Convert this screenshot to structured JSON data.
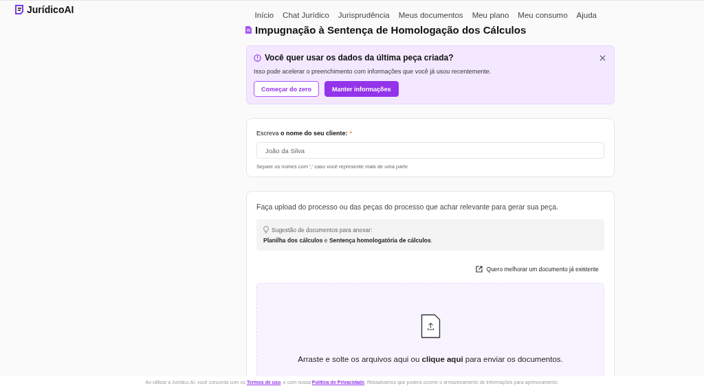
{
  "brand": {
    "name": "JurídicoAI"
  },
  "nav": [
    "Início",
    "Chat Jurídico",
    "Jurisprudência",
    "Meus documentos",
    "Meu plano",
    "Meu consumo",
    "Ajuda"
  ],
  "page_title": "Impugnação à Sentença de Homologação dos Cálculos",
  "alert": {
    "title": "Você quer usar os dados da última peça criada?",
    "text": "Isso pode acelerar o preenchimento com informações que você já usou recentemente.",
    "buttons": [
      {
        "label": "Começar do zero",
        "kind": "outline"
      },
      {
        "label": "Manter informações",
        "kind": "primary"
      }
    ]
  },
  "client_field": {
    "label": "Escreva **o nome do seu cliente:**",
    "required_mark": "*",
    "placeholder": "João da Silva",
    "hint": "Separe os nomes com ';' caso você represente mais de uma parte"
  },
  "upload": {
    "intro": "Faça upload do processo ou das peças do processo que achar relevante para gerar sua peça.",
    "suggestion_title": "Sugestão de documentos para anexar:",
    "suggestion_text": "**Planilha dos cálculos** e **Sentença homologatória de cálculos**.",
    "improve_link": "Quero melhorar um documento já existente",
    "drop_text": "Arraste e solte os arquivos aqui ou **clique aqui** para enviar os documentos."
  },
  "footer": {
    "before": "Ao utilizar a Jurídico.AI, você concorda com os",
    "terms_link": "Termos de uso",
    "middle": ". e com nossa",
    "privacy_link": "Política de Privacidade",
    "after": ". Ressalvamos que poderá ocorrer o armazenamento de informações para aprimoramento."
  }
}
